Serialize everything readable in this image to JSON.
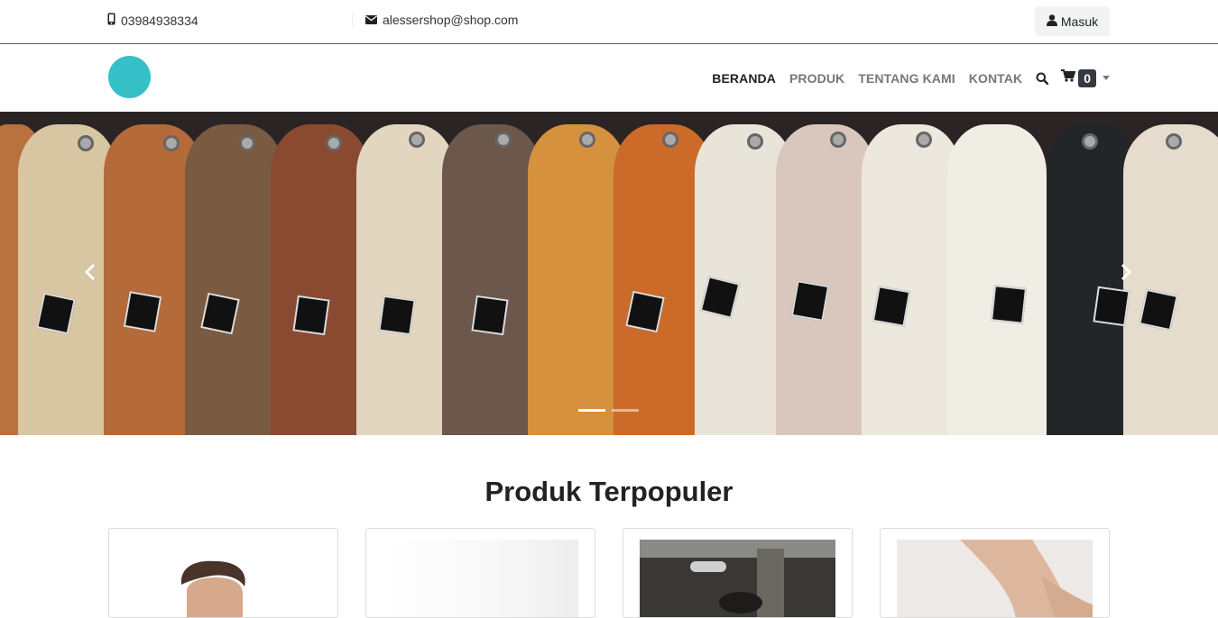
{
  "topbar": {
    "phone": "03984938334",
    "email": "alessershop@shop.com",
    "login_label": "Masuk"
  },
  "nav": {
    "items": [
      {
        "label": "BERANDA",
        "active": true
      },
      {
        "label": "PRODUK",
        "active": false
      },
      {
        "label": "TENTANG KAMI",
        "active": false
      },
      {
        "label": "KONTAK",
        "active": false
      }
    ],
    "cart_count": "0"
  },
  "hero": {
    "slides_count": 2,
    "active_slide": 1
  },
  "section": {
    "title": "Produk Terpopuler"
  },
  "colors": {
    "brand_logo": "#35c0c8",
    "badge_bg": "#343a40",
    "nav_active": "#222222",
    "nav_inactive": "#777777"
  },
  "icons": {
    "phone": "mobile-phone-icon",
    "email": "envelope-icon",
    "login": "user-icon",
    "search": "search-icon",
    "cart": "shopping-cart-icon",
    "prev": "chevron-left-icon",
    "next": "chevron-right-icon"
  }
}
